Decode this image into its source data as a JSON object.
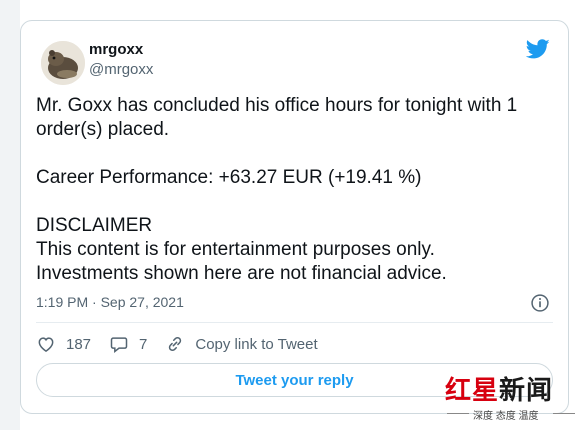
{
  "user": {
    "name": "mrgoxx",
    "handle": "@mrgoxx"
  },
  "tweet": {
    "line1": "Mr. Goxx has concluded his office hours for tonight with 1 order(s) placed.",
    "line2": "Career Performance: +63.27 EUR (+19.41 %)",
    "line3": "DISCLAIMER",
    "line4": "This content is for entertainment purposes only.",
    "line5": "Investments shown here are not financial advice."
  },
  "meta": {
    "timestamp": "1:19 PM · Sep 27, 2021"
  },
  "actions": {
    "likes": "187",
    "replies": "7",
    "copy_link": "Copy link to Tweet",
    "reply_button": "Tweet your reply"
  },
  "watermark": {
    "red": "红星",
    "black": "新闻",
    "tagline": "深度 态度 温度"
  },
  "colors": {
    "accent": "#1d9bf0",
    "text": "#0f1419",
    "muted": "#536471",
    "watermark_red": "#d7000f"
  },
  "icons": [
    "twitter-bird-icon",
    "info-icon",
    "heart-icon",
    "reply-icon",
    "link-icon"
  ]
}
